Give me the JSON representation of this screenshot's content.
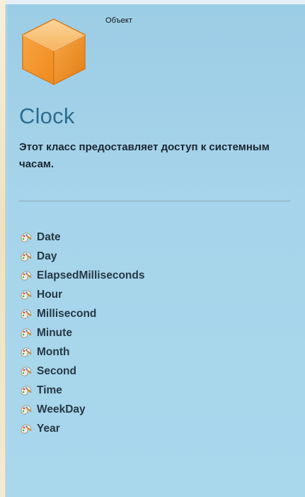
{
  "header": {
    "kind_label": "Объект"
  },
  "object": {
    "name": "Clock",
    "description": "Этот класс предоставляет доступ к системным часам."
  },
  "members": [
    {
      "label": "Date",
      "icon": "property-icon"
    },
    {
      "label": "Day",
      "icon": "property-icon"
    },
    {
      "label": "ElapsedMilliseconds",
      "icon": "property-icon"
    },
    {
      "label": "Hour",
      "icon": "property-icon"
    },
    {
      "label": "Millisecond",
      "icon": "property-icon"
    },
    {
      "label": "Minute",
      "icon": "property-icon"
    },
    {
      "label": "Month",
      "icon": "property-icon"
    },
    {
      "label": "Second",
      "icon": "property-icon"
    },
    {
      "label": "Time",
      "icon": "property-icon"
    },
    {
      "label": "WeekDay",
      "icon": "property-icon"
    },
    {
      "label": "Year",
      "icon": "property-icon"
    }
  ],
  "colors": {
    "panel_bg": "#a6d4ea",
    "title": "#2e6e8f",
    "cube": "#f7a443"
  }
}
